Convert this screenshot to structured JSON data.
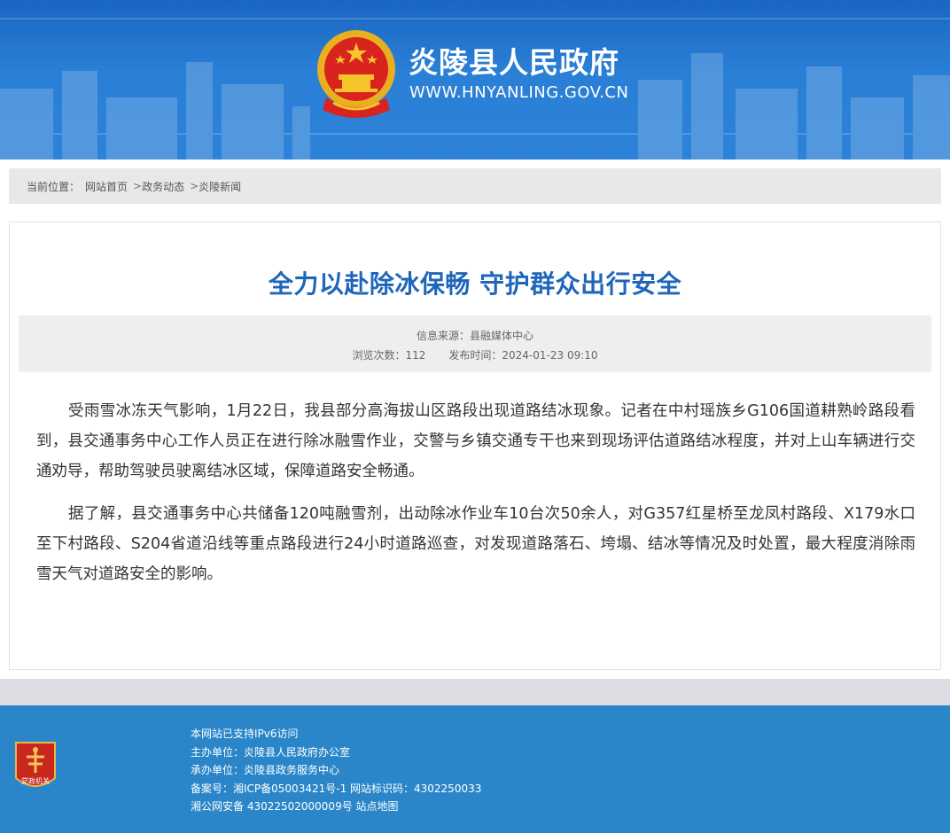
{
  "header": {
    "site_name": "炎陵县人民政府",
    "site_url": "WWW.HNYANLING.GOV.CN",
    "emblem_icon": "national-emblem-icon"
  },
  "breadcrumb": {
    "prefix": "当前位置：",
    "items": [
      "网站首页",
      "政务动态",
      "炎陵新闻"
    ]
  },
  "article": {
    "title": "全力以赴除冰保畅 守护群众出行安全",
    "source_label": "信息来源：县融媒体中心",
    "views_label": "浏览次数：",
    "views": "112",
    "publish_label": "发布时间：",
    "publish_time": "2024-01-23 09:10",
    "paragraphs": [
      "受雨雪冰冻天气影响，1月22日，我县部分高海拔山区路段出现道路结冰现象。记者在中村瑶族乡G106国道耕熟岭路段看到，县交通事务中心工作人员正在进行除冰融雪作业，交警与乡镇交通专干也来到现场评估道路结冰程度，并对上山车辆进行交通劝导，帮助驾驶员驶离结冰区域，保障道路安全畅通。",
      "据了解，县交通事务中心共储备120吨融雪剂，出动除冰作业车10台次50余人，对G357红星桥至龙凤村路段、X179水口至下村路段、S204省道沿线等重点路段进行24小时道路巡查，对发现道路落石、垮塌、结冰等情况及时处置，最大程度消除雨雪天气对道路安全的影响。"
    ]
  },
  "footer": {
    "badge_text": "党政机关",
    "lines": [
      "本网站已支持IPv6访问",
      "主办单位：炎陵县人民政府办公室",
      "承办单位：炎陵县政务服务中心",
      "备案号：湘ICP备05003421号-1 网站标识码：4302250033",
      "湘公网安备 43022502000009号 站点地图"
    ]
  },
  "colors": {
    "header_blue": "#1a66c2",
    "title_blue": "#1f66bb",
    "footer_blue": "#2a86c8"
  }
}
